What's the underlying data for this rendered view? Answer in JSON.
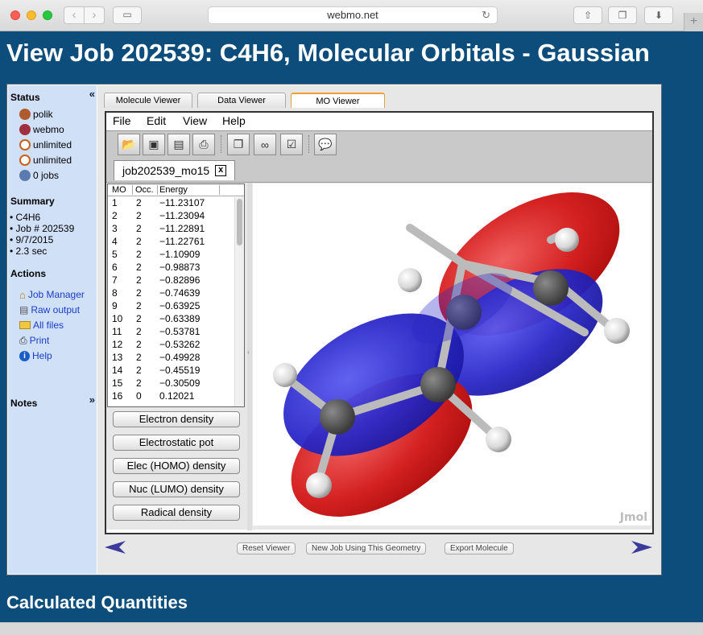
{
  "browser": {
    "url": "webmo.net",
    "new_tab": "+"
  },
  "page": {
    "title": "View Job 202539: C4H6, Molecular Orbitals - Gaussian",
    "section_title": "Calculated Quantities"
  },
  "sidebar": {
    "status_heading": "Status",
    "collapse": "«",
    "status_items": [
      {
        "label": "polik",
        "icon": "user-icon"
      },
      {
        "label": "webmo",
        "icon": "group-icon"
      },
      {
        "label": "unlimited",
        "icon": "clock-icon"
      },
      {
        "label": "unlimited",
        "icon": "clock-icon"
      },
      {
        "label": "0 jobs",
        "icon": "gear-icon"
      }
    ],
    "summary_heading": "Summary",
    "summary_items": [
      "C4H6",
      "Job # 202539",
      "9/7/2015",
      "2.3 sec"
    ],
    "actions_heading": "Actions",
    "actions": [
      {
        "label": "Job Manager",
        "icon": "home-icon"
      },
      {
        "label": "Raw output",
        "icon": "document-icon"
      },
      {
        "label": "All files",
        "icon": "folder-icon"
      },
      {
        "label": "Print",
        "icon": "printer-icon"
      },
      {
        "label": "Help",
        "icon": "info-icon"
      }
    ],
    "notes_heading": "Notes",
    "notes_expand": "»"
  },
  "tabs": [
    "Molecule Viewer",
    "Data Viewer",
    "MO Viewer"
  ],
  "active_tab": "MO Viewer",
  "menu": [
    "File",
    "Edit",
    "View",
    "Help"
  ],
  "toolbar_icons": [
    "open-folder-icon",
    "save-icon",
    "save-as-icon",
    "print-icon",
    "copy-icon",
    "binoculars-icon",
    "checklist-icon",
    "info-bubble-icon"
  ],
  "doc_tab": {
    "label": "job202539_mo15",
    "close": "x"
  },
  "mo_table": {
    "headers": [
      "MO",
      "Occ.",
      "Energy"
    ],
    "rows": [
      [
        "1",
        "2",
        "−11.23107"
      ],
      [
        "2",
        "2",
        "−11.23094"
      ],
      [
        "3",
        "2",
        "−11.22891"
      ],
      [
        "4",
        "2",
        "−11.22761"
      ],
      [
        "5",
        "2",
        "−1.10909"
      ],
      [
        "6",
        "2",
        "−0.98873"
      ],
      [
        "7",
        "2",
        "−0.82896"
      ],
      [
        "8",
        "2",
        "−0.74639"
      ],
      [
        "9",
        "2",
        "−0.63925"
      ],
      [
        "10",
        "2",
        "−0.63389"
      ],
      [
        "11",
        "2",
        "−0.53781"
      ],
      [
        "12",
        "2",
        "−0.53262"
      ],
      [
        "13",
        "2",
        "−0.49928"
      ],
      [
        "14",
        "2",
        "−0.45519"
      ],
      [
        "15",
        "2",
        "−0.30509"
      ],
      [
        "16",
        "0",
        "0.12021"
      ]
    ]
  },
  "density_buttons": [
    "Electron density",
    "Electrostatic pot",
    "Elec (HOMO) density",
    "Nuc (LUMO) density",
    "Radical density"
  ],
  "viewer": {
    "watermark": "Jmol"
  },
  "bottom_buttons": [
    "Reset Viewer",
    "New Job Using This Geometry",
    "Export Molecule"
  ],
  "colors": {
    "page_bg": "#0d4d7c",
    "sidebar_bg": "#cfe0f7",
    "lobe_red": "#d42020",
    "lobe_blue": "#2a28c8",
    "link": "#1a3cc9"
  }
}
